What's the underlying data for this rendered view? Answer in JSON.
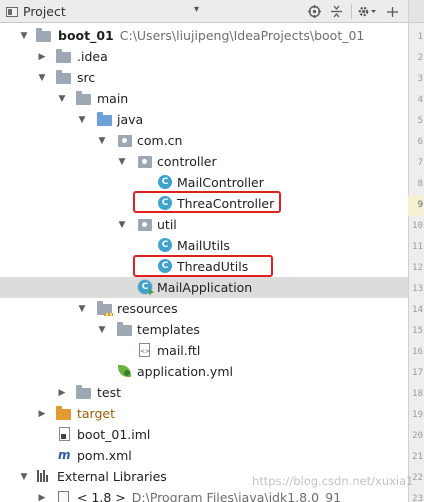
{
  "header": {
    "title": "Project",
    "caret": "▾",
    "icons": [
      "target-icon",
      "collapse-icon",
      "gear-icon",
      "hide-icon"
    ]
  },
  "tree": {
    "root": {
      "name": "boot_01",
      "path": "C:\\Users\\liujipeng\\IdeaProjects\\boot_01"
    },
    "idea": ".idea",
    "src": "src",
    "main": "main",
    "java": "java",
    "com_cn": "com.cn",
    "controller": "controller",
    "mail_controller": "MailController",
    "threa_controller": "ThreaController",
    "util": "util",
    "mail_utils": "MailUtils",
    "thread_utils": "ThreadUtils",
    "mail_application": "MailApplication",
    "resources": "resources",
    "templates": "templates",
    "mail_ftl": "mail.ftl",
    "application_yml": "application.yml",
    "test": "test",
    "target": "target",
    "boot_iml": "boot_01.iml",
    "pom_xml": "pom.xml",
    "external_libraries": "External Libraries",
    "jdk": {
      "name": "< 1.8 >",
      "path": "D:\\Program Files\\java\\jdk1.8.0_91"
    }
  },
  "gutter": {
    "line_numbers": [
      "1",
      "2",
      "3",
      "4",
      "5",
      "6",
      "7",
      "8",
      "9",
      "10",
      "11",
      "12",
      "13",
      "14",
      "15",
      "16",
      "17",
      "18",
      "19",
      "20",
      "21",
      "22",
      "23"
    ],
    "current_line": "9"
  },
  "watermark": "https://blog.csdn.net/xuxia1",
  "colors": {
    "highlight": "#e31e1e",
    "selected_row": "#dcdcdc",
    "class_icon": "#3fa3cf"
  }
}
